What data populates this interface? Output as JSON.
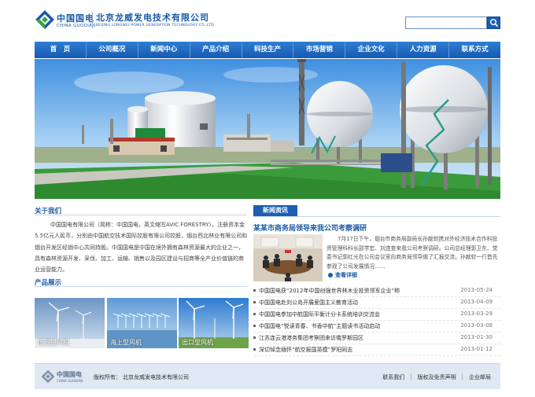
{
  "header": {
    "logo_cn": "中国国电",
    "logo_en": "CHINA GUODIAN",
    "company_cn": "北京龙威发电技术有限公司",
    "company_en": "BEIJING LONGWEI POWER GENERATION TECHNOLOGY CO.,LTD",
    "search_placeholder": ""
  },
  "nav": [
    "首　页",
    "公司概况",
    "新闻中心",
    "产品介绍",
    "科技生产",
    "市场营销",
    "企业文化",
    "人力资源",
    "联系方式"
  ],
  "about": {
    "title": "关于我们",
    "text": "中国国电有限公司（简称：中国国电，英文缩写AVIC FORESTRY），注册资本金5.5亿元人民币，分别由中国航空技术国际控股有限公司控股，烟台西北林业有限公司和烟台开发区经销中心共同持股。中国国电是中国在境外拥有森林资源最大的企业之一，具有森林资源开发、采伐、加工、运输、销售以及园区建设与招商等全产业价值链的商业运营能力。"
  },
  "products": {
    "title": "产品展示",
    "items": [
      {
        "caption": "低温型风机"
      },
      {
        "caption": "海上型风机"
      },
      {
        "caption": "出口型风机"
      }
    ]
  },
  "news": {
    "tab": "新闻资讯",
    "headline": "某某市商务局领导来我公司考察调研",
    "summary": "7月17日下午，烟台市商务局副局长孙献软携对外经济技术合作科投资管理科科长邵学宏、刘连查来我公司考察调研。公司总经理郭卫东、党委书记郭红光在公司会议室向商务局领导做了汇报交流。孙献软一行首先参观了公司发展情况……",
    "more": "查看详细",
    "list": [
      {
        "title": "中国国电获“2012年中国创强世界林木业投资领军企业”称",
        "date": "2013-05-24"
      },
      {
        "title": "中国国电赴刘公岛开展爱国主义教育活动",
        "date": "2013-04-09"
      },
      {
        "title": "中国国电参加中航国际平衡计分卡系统培训交流会",
        "date": "2013-03-29"
      },
      {
        "title": "中国国电“悦读青春、书香中航”主题读书活动启动",
        "date": "2013-03-08"
      },
      {
        "title": "江苏连云港港务集团考察团来访俄罗斯园区",
        "date": "2013-01-30"
      },
      {
        "title": "深切悼念缅怀“航空报国英模”罗阳同志",
        "date": "2013-01-12"
      }
    ]
  },
  "footer": {
    "logo_cn": "中国国电",
    "logo_en": "CHINA GUODIAN",
    "copyright_label": "版权所有：",
    "copyright": "北京龙威发电技术有限公司",
    "links": [
      "联系我们",
      "版权及免责声明",
      "企业邮局"
    ]
  },
  "colors": {
    "brand": "#1a5aa8",
    "nav": "#1d5fb1",
    "footer": "#dfe8f3"
  }
}
